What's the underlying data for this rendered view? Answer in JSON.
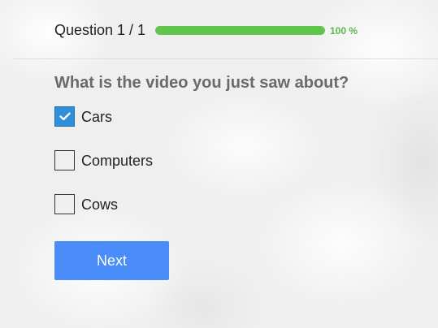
{
  "header": {
    "counter": "Question 1 / 1",
    "progress_percent": 100,
    "progress_label": "100 %"
  },
  "question": {
    "text": "What is the video you just saw about?",
    "options": [
      {
        "label": "Cars",
        "checked": true
      },
      {
        "label": "Computers",
        "checked": false
      },
      {
        "label": "Cows",
        "checked": false
      }
    ]
  },
  "actions": {
    "next_label": "Next"
  },
  "colors": {
    "progress_fill": "#5fc54b",
    "checkbox_checked": "#2f8fd8",
    "next_button": "#4b8df8"
  },
  "icons": {
    "check": "check-icon"
  }
}
